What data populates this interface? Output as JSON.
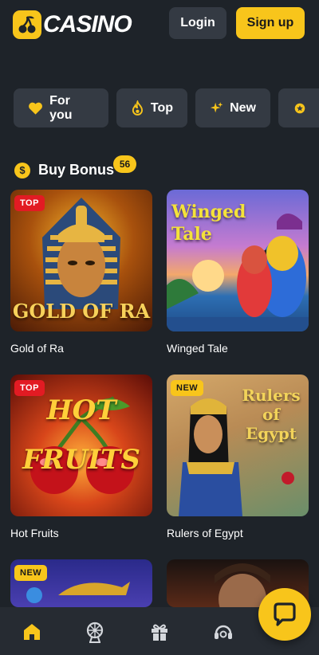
{
  "header": {
    "logo_text": "CASINO",
    "login_label": "Login",
    "signup_label": "Sign up"
  },
  "categories": [
    {
      "label": "For you",
      "icon": "heart-icon"
    },
    {
      "label": "Top",
      "icon": "flame-icon"
    },
    {
      "label": "New",
      "icon": "sparkles-icon"
    },
    {
      "label": "",
      "icon": "star-icon"
    }
  ],
  "section": {
    "title": "Buy Bonus",
    "count": "56",
    "icon": "dollar-coin-icon"
  },
  "games": [
    {
      "name": "Gold of Ra",
      "tag": "TOP",
      "thumb_text": "GOLD OF RA"
    },
    {
      "name": "Winged Tale",
      "tag": "",
      "thumb_text": "Winged Tale"
    },
    {
      "name": "Hot Fruits",
      "tag": "TOP",
      "thumb_text": "HOT FRUITS"
    },
    {
      "name": "Rulers of Egypt",
      "tag": "NEW",
      "thumb_text": "Rulers of Egypt"
    },
    {
      "name": "",
      "tag": "NEW",
      "thumb_text": ""
    },
    {
      "name": "",
      "tag": "",
      "thumb_text": ""
    }
  ],
  "bottom_nav": [
    {
      "icon": "home-icon",
      "active": true
    },
    {
      "icon": "ferris-wheel-icon",
      "active": false
    },
    {
      "icon": "gift-icon",
      "active": false
    },
    {
      "icon": "support-headset-icon",
      "active": false
    }
  ],
  "colors": {
    "background": "#1e2329",
    "accent": "#f8c51b",
    "chip": "#343a43",
    "top_tag": "#e21b23"
  }
}
